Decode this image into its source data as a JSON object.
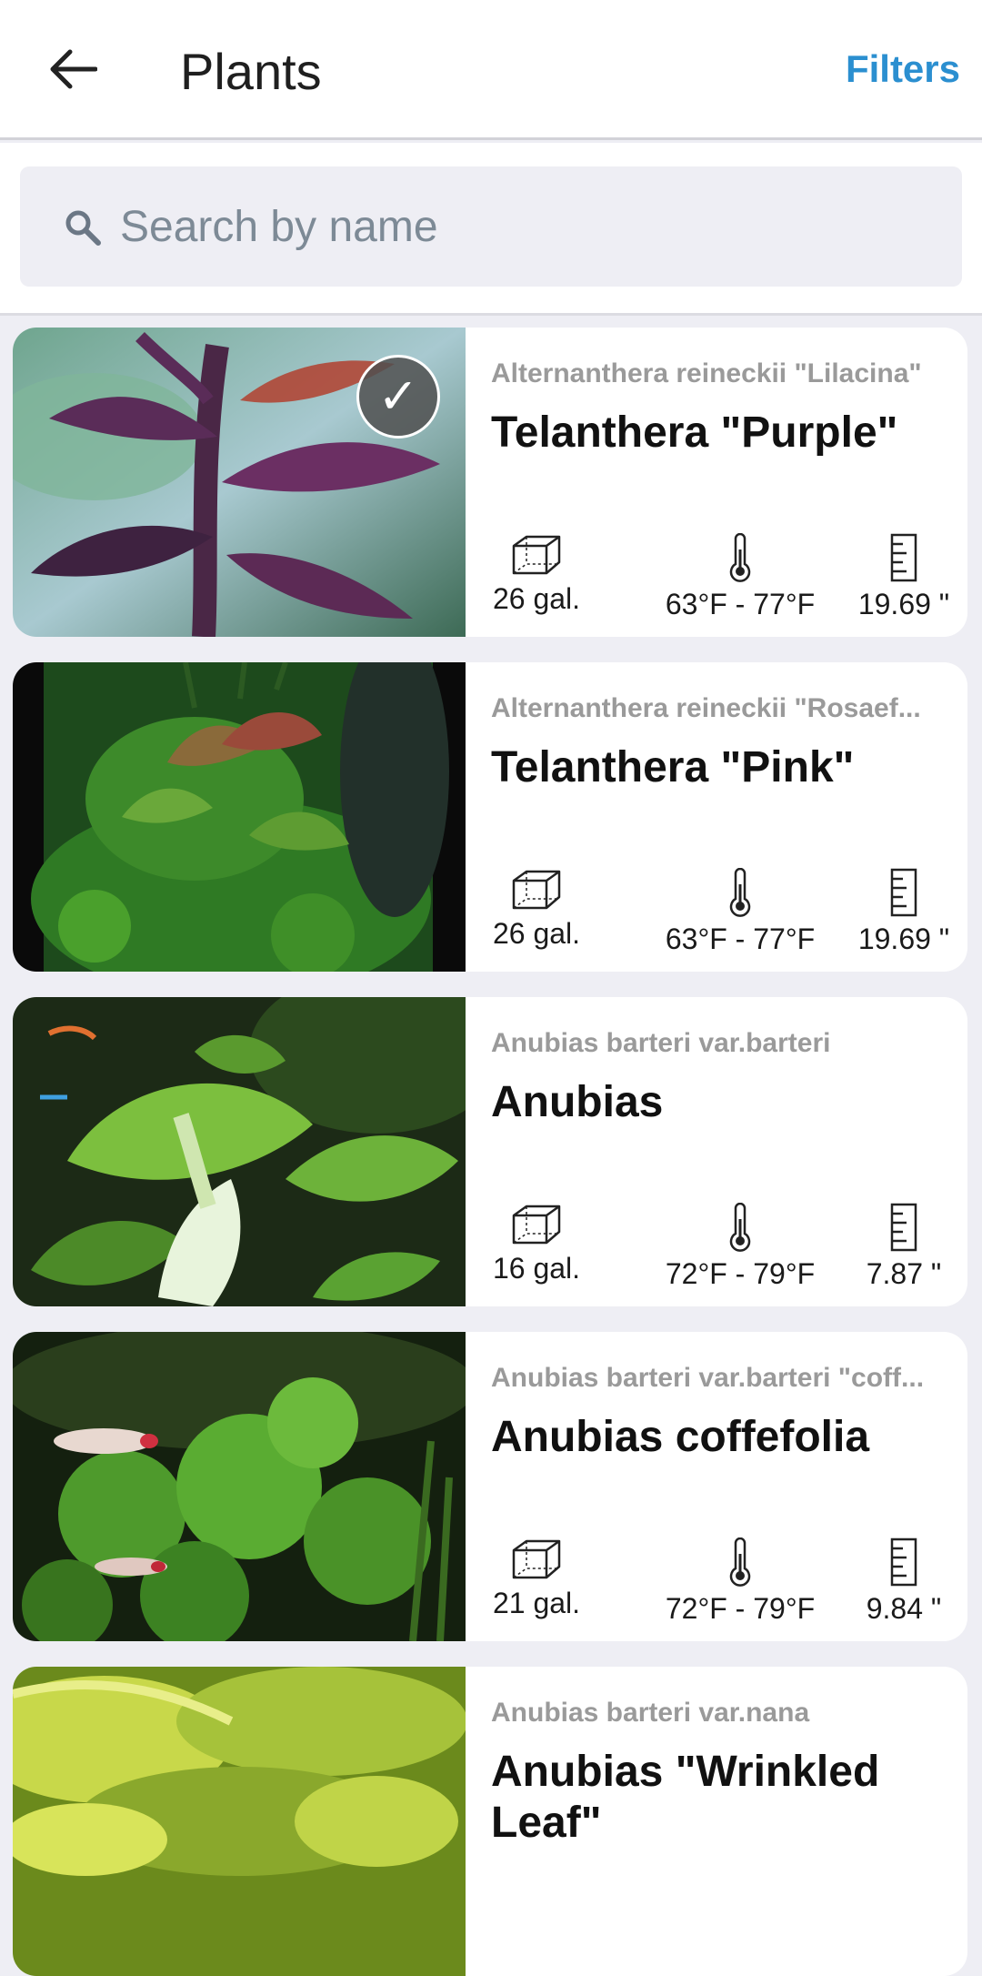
{
  "header": {
    "title": "Plants",
    "filters_label": "Filters"
  },
  "search": {
    "placeholder": "Search by name"
  },
  "plants": [
    {
      "scientific_name": "Alternanthera reineckii \"Lilacina\"",
      "common_name": "Telanthera \"Purple\"",
      "tank": "26 gal.",
      "temperature": "63°F - 77°F",
      "height": "19.69 \"",
      "selected": true,
      "image_icon": "plant-photo"
    },
    {
      "scientific_name": "Alternanthera reineckii \"Rosaef...",
      "common_name": "Telanthera \"Pink\"",
      "tank": "26 gal.",
      "temperature": "63°F - 77°F",
      "height": "19.69 \"",
      "selected": false,
      "image_icon": "plant-photo"
    },
    {
      "scientific_name": "Anubias barteri var.barteri",
      "common_name": "Anubias",
      "tank": "16 gal.",
      "temperature": "72°F - 79°F",
      "height": "7.87 \"",
      "selected": false,
      "image_icon": "plant-photo"
    },
    {
      "scientific_name": "Anubias barteri var.barteri \"coff...",
      "common_name": "Anubias coffefolia",
      "tank": "21 gal.",
      "temperature": "72°F - 79°F",
      "height": "9.84 \"",
      "selected": false,
      "image_icon": "plant-photo"
    },
    {
      "scientific_name": "Anubias barteri var.nana",
      "common_name": "Anubias \"Wrinkled Leaf\"",
      "tank": "",
      "temperature": "",
      "height": "",
      "selected": false,
      "image_icon": "plant-photo"
    }
  ],
  "colors": {
    "accent": "#2b8fd0",
    "background": "#eeeef4",
    "card": "#ffffff",
    "scientific_text": "#9a9a9a"
  },
  "icons": {
    "back": "arrow-left-icon",
    "search": "search-icon",
    "tank": "tank-icon",
    "temperature": "thermometer-icon",
    "height": "ruler-icon",
    "selected": "checkmark-icon"
  }
}
